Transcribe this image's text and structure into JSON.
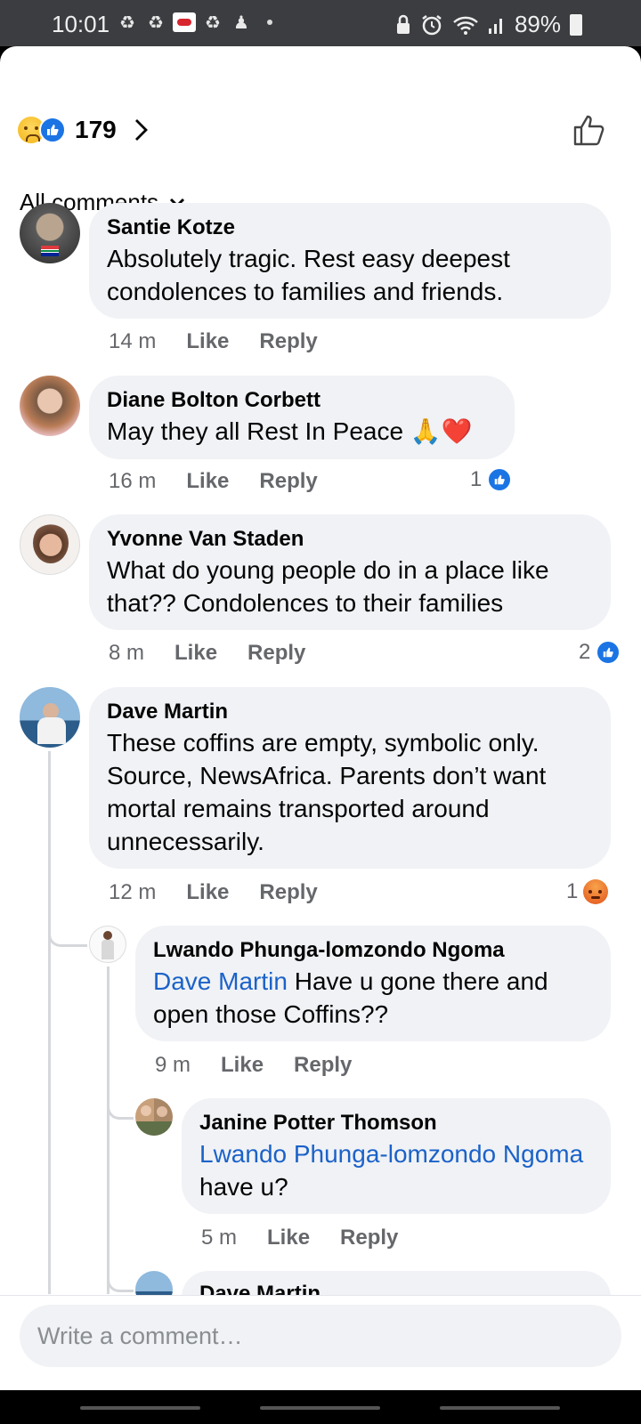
{
  "status_bar": {
    "time": "10:01",
    "battery": "89%",
    "icons": [
      "sync-icon",
      "sync-icon",
      "app-badge-icon",
      "sync-icon",
      "person-icon",
      "dot-icon",
      "lock-icon",
      "alarm-icon",
      "wifi-icon",
      "signal-icon",
      "battery-icon"
    ]
  },
  "reactions": {
    "count": "179",
    "types": [
      "sad",
      "like"
    ]
  },
  "filter": {
    "label": "All comments"
  },
  "comments": [
    {
      "name": "Santie Kotze",
      "text": "Absolutely tragic. Rest easy deepest condolences to families and friends.",
      "time": "14 m",
      "like": "Like",
      "reply": "Reply"
    },
    {
      "name": "Diane Bolton Corbett",
      "text": "May they all Rest In Peace 🙏❤️",
      "time": "16 m",
      "like": "Like",
      "reply": "Reply",
      "reaction_count": "1"
    },
    {
      "name": "Yvonne Van Staden",
      "text": "What do young people do in a place like that?? Condolences to their families",
      "time": "8 m",
      "like": "Like",
      "reply": "Reply",
      "reaction_count": "2"
    },
    {
      "name": "Dave Martin",
      "text": "These coffins are empty, symbolic only. Source, NewsAfrica. Parents don’t want mortal remains transported around unnecessarily.",
      "time": "12 m",
      "like": "Like",
      "reply": "Reply",
      "reaction_count": "1"
    },
    {
      "name": "Lwando Phunga-lomzondo Ngoma",
      "mention": "Dave Martin",
      "text": " Have u gone there and open those Coffins??",
      "time": "9 m",
      "like": "Like",
      "reply": "Reply"
    },
    {
      "name": "Janine Potter Thomson",
      "mention": "Lwando Phunga-lomzondo Ngoma",
      "text": " have u?",
      "time": "5 m",
      "like": "Like",
      "reply": "Reply"
    },
    {
      "name": "Dave Martin"
    }
  ],
  "composer": {
    "placeholder": "Write a comment…"
  },
  "colors": {
    "accent": "#1b74e4",
    "mention": "#1b62c9",
    "bubble": "#f0f2f5",
    "meta": "#65676b"
  }
}
